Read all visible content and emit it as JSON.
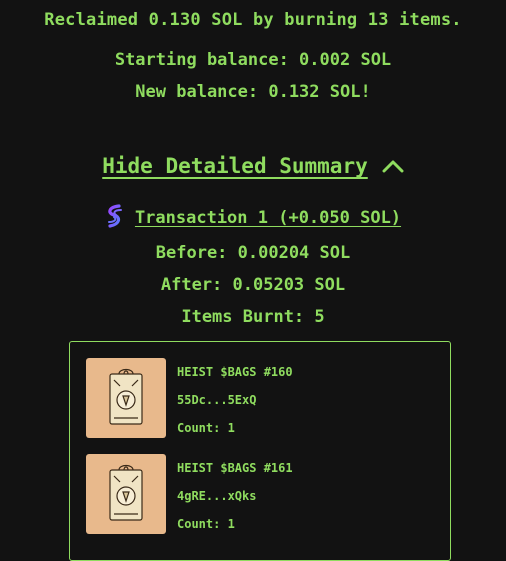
{
  "summary": {
    "reclaimed": "Reclaimed 0.130 SOL by burning 13 items.",
    "starting_balance": "Starting balance: 0.002 SOL",
    "new_balance": "New balance: 0.132 SOL!"
  },
  "details_toggle": {
    "label": "Hide Detailed Summary",
    "icon": "chevron-up-icon"
  },
  "transaction": {
    "icon": "solana-icon",
    "label": "Transaction 1 (+0.050 SOL)",
    "before": "Before: 0.00204 SOL",
    "after": "After: 0.05203 SOL",
    "items_burnt": "Items Burnt: 5",
    "items": [
      {
        "name": "HEIST $BAGS #160",
        "address": "55Dc...5ExQ",
        "count": "Count: 1"
      },
      {
        "name": "HEIST $BAGS #161",
        "address": "4gRE...xQks",
        "count": "Count: 1"
      }
    ]
  },
  "colors": {
    "background": "#121212",
    "accent": "#8fdc5f",
    "thumb_bg": "#e8b98c"
  }
}
